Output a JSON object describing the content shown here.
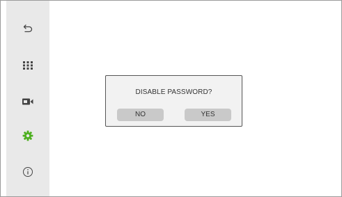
{
  "sidebar": {
    "items": [
      {
        "icon": "back-arrow-icon"
      },
      {
        "icon": "apps-grid-icon"
      },
      {
        "icon": "camera-icon"
      },
      {
        "icon": "gear-icon",
        "active_color": "#4caf1e"
      },
      {
        "icon": "info-icon"
      }
    ]
  },
  "dialog": {
    "title": "DISABLE PASSWORD?",
    "no_label": "NO",
    "yes_label": "YES"
  },
  "colors": {
    "sidebar_bg": "#e9e9e9",
    "dialog_bg": "#f2f2f2",
    "button_bg": "#c9c9c9",
    "active_icon": "#4caf1e",
    "icon": "#444444"
  }
}
